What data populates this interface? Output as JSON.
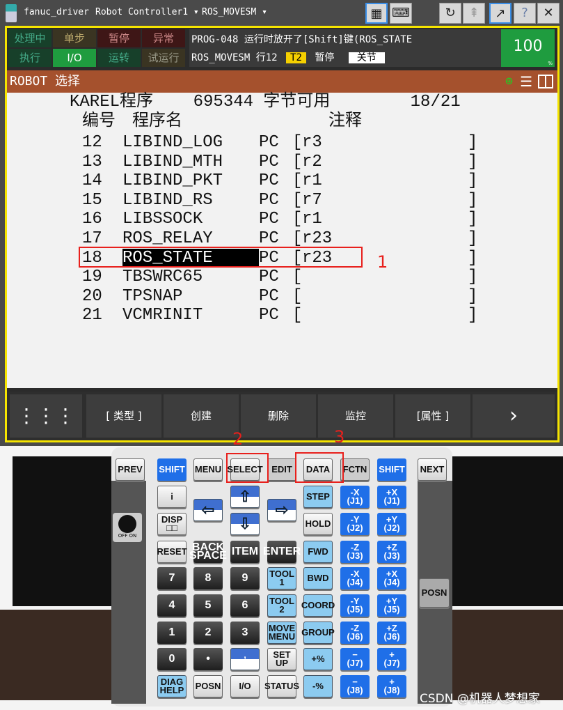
{
  "titlebar": {
    "app": "fanuc_driver",
    "controller": "Robot Controller1",
    "program": "ROS_MOVESM",
    "buttons": [
      "tp-icon",
      "keyboard-icon",
      "refresh-icon",
      "jog-icon",
      "export-icon",
      "help-icon",
      "close-icon"
    ]
  },
  "status": {
    "indicators": [
      [
        "处理中",
        "单步",
        "暂停",
        "异常"
      ],
      [
        "执行",
        "I/O",
        "运转",
        "试运行"
      ]
    ],
    "message_line1": "PROG-048 运行时放开了[Shift]键(ROS_STATE",
    "message_prog": "ROS_MOVESM",
    "message_line": "行12",
    "mode": "T2",
    "state": "暂停",
    "coord": "关节",
    "override": "100",
    "override_unit": "%"
  },
  "screen": {
    "title": "ROBOT 选择",
    "header": "KAREL程序    695344 字节可用        18/21",
    "col_no": "编号",
    "col_name": "程序名",
    "col_comment": "注释",
    "rows": [
      {
        "no": "12",
        "name": "LIBIND_LOG",
        "type": "PC",
        "comment": "r3"
      },
      {
        "no": "13",
        "name": "LIBIND_MTH",
        "type": "PC",
        "comment": "r2"
      },
      {
        "no": "14",
        "name": "LIBIND_PKT",
        "type": "PC",
        "comment": "r1"
      },
      {
        "no": "15",
        "name": "LIBIND_RS",
        "type": "PC",
        "comment": "r7"
      },
      {
        "no": "16",
        "name": "LIBSSOCK",
        "type": "PC",
        "comment": "r1"
      },
      {
        "no": "17",
        "name": "ROS_RELAY",
        "type": "PC",
        "comment": "r23"
      },
      {
        "no": "18",
        "name": "ROS_STATE",
        "type": "PC",
        "comment": "r23",
        "selected": true
      },
      {
        "no": "19",
        "name": "TBSWRC65",
        "type": "PC",
        "comment": ""
      },
      {
        "no": "20",
        "name": "TPSNAP",
        "type": "PC",
        "comment": ""
      },
      {
        "no": "21",
        "name": "VCMRINIT",
        "type": "PC",
        "comment": ""
      }
    ]
  },
  "function_keys": [
    "[ 类型 ]",
    "创建",
    "删除",
    "监控",
    "[属性 ]"
  ],
  "annotations": [
    "1",
    "2",
    "3"
  ],
  "keypad": {
    "top": [
      "PREV",
      "SHIFT",
      "MENU",
      "SELECT",
      "EDIT",
      "DATA",
      "FCTN",
      "SHIFT",
      "NEXT"
    ],
    "rows": [
      [
        "i",
        "",
        "",
        "",
        "STEP",
        "-X\n(J1)",
        "+X\n(J1)"
      ],
      [
        "DISP\n□□",
        "",
        "",
        "",
        "HOLD",
        "-Y\n(J2)",
        "+Y\n(J2)"
      ],
      [
        "RESET",
        "BACK\nSPACE",
        "ITEM",
        "ENTER",
        "FWD",
        "-Z\n(J3)",
        "+Z\n(J3)"
      ],
      [
        "7",
        "8",
        "9",
        "TOOL\n1",
        "BWD",
        "-X\n(J4)",
        "+X\n(J4)"
      ],
      [
        "4",
        "5",
        "6",
        "TOOL\n2",
        "COORD",
        "-Y\n(J5)",
        "+Y\n(J5)"
      ],
      [
        "1",
        "2",
        "3",
        "MOVE\nMENU",
        "GROUP",
        "-Z\n(J6)",
        "+Z\n(J6)"
      ],
      [
        "0",
        "•",
        "‚\n—",
        "SET\nUP",
        "+%",
        "−\n(J7)",
        "+\n(J7)"
      ],
      [
        "DIAG\nHELP",
        "POSN",
        "I/O",
        "STATUS",
        "-%",
        "−\n(J8)",
        "+\n(J8)"
      ]
    ],
    "arrows": [
      "⇦",
      "⇧",
      "⇩",
      "⇨"
    ],
    "side_posn": "POSN",
    "switch": "OFF  ON"
  },
  "watermark": "CSDN @机器人梦想家"
}
